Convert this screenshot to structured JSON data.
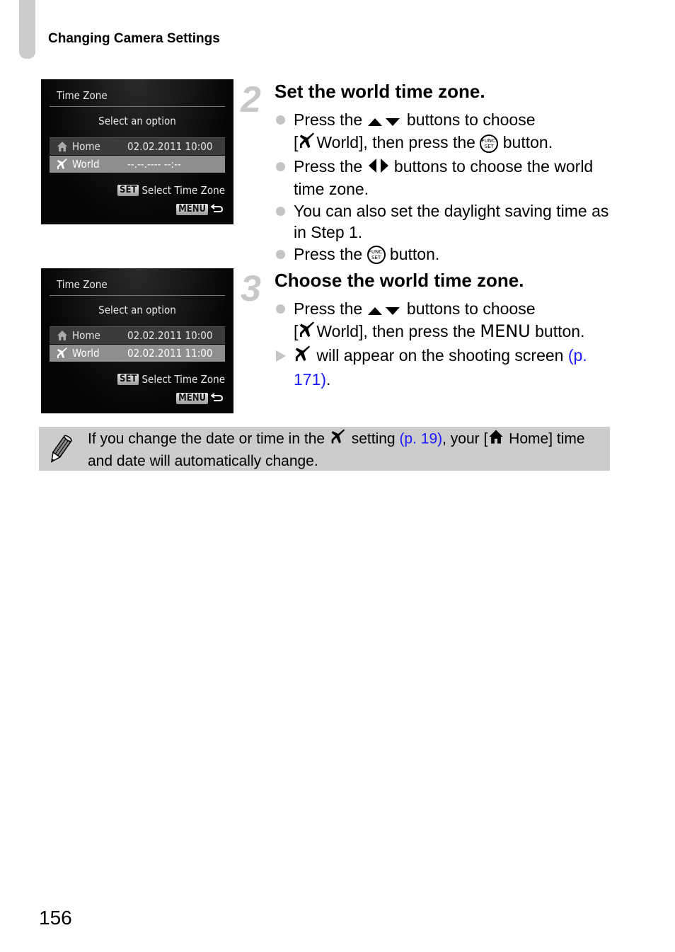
{
  "header": {
    "title": "Changing Camera Settings"
  },
  "screens": [
    {
      "title": "Time Zone",
      "subtitle": "Select an option",
      "rows": [
        {
          "icon": "home-icon",
          "label": "Home",
          "value": "02.02.2011 10:00",
          "selected": false
        },
        {
          "icon": "airplane-icon",
          "label": "World",
          "value": "--.--.---- --:--",
          "selected": true
        }
      ],
      "set_key": "SET",
      "set_label": "Select Time Zone",
      "menu_key": "MENU"
    },
    {
      "title": "Time Zone",
      "subtitle": "Select an option",
      "rows": [
        {
          "icon": "home-icon",
          "label": "Home",
          "value": "02.02.2011 10:00",
          "selected": false
        },
        {
          "icon": "airplane-icon",
          "label": "World",
          "value": "02.02.2011 11:00",
          "selected": true
        }
      ],
      "set_key": "SET",
      "set_label": "Select Time Zone",
      "menu_key": "MENU"
    }
  ],
  "steps": [
    {
      "number": "2",
      "heading": "Set the world time zone.",
      "b1_a": "Press the ",
      "b1_b": " buttons to choose",
      "b1_c": "[",
      "b1_d": "World], then press the ",
      "b1_e": " button.",
      "b2_a": "Press the ",
      "b2_b": " buttons to choose the world time zone.",
      "b3": "You can also set the daylight saving time as in Step 1.",
      "b4_a": "Press the ",
      "b4_b": " button."
    },
    {
      "number": "3",
      "heading": "Choose the world time zone.",
      "b1_a": "Press the ",
      "b1_b": " buttons to choose",
      "b1_c": "[",
      "b1_d": "World], then press the ",
      "b1_menu": "MENU",
      "b1_e": " button.",
      "r1_a": " will appear on the shooting screen ",
      "r1_link": "(p. 171)",
      "r1_end": "."
    }
  ],
  "func_key": {
    "line1": "FUNC.",
    "line2": "SET"
  },
  "note": {
    "a": "If you change the date or time in the ",
    "b": " setting ",
    "link": "(p. 19)",
    "c": ", your [",
    "d": " Home] time and date will automatically change."
  },
  "page_number": "156"
}
